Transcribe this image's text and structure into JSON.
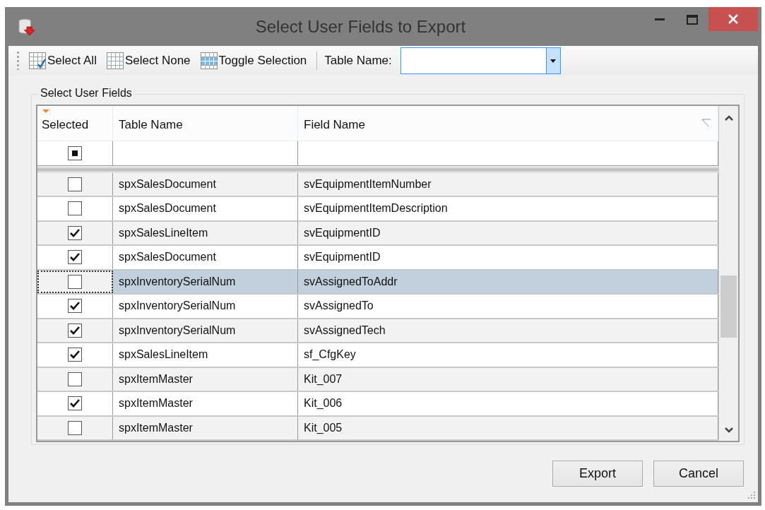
{
  "window": {
    "title": "Select User Fields to Export"
  },
  "toolbar": {
    "buttons": [
      {
        "label": "Select All",
        "kind": "all"
      },
      {
        "label": "Select None",
        "kind": "none"
      },
      {
        "label": "Toggle Selection",
        "kind": "toggle"
      }
    ],
    "table_name_label": "Table Name:"
  },
  "group": {
    "title": "Select User Fields"
  },
  "table": {
    "columns": [
      "Selected",
      "Table Name",
      "Field Name"
    ],
    "filter_checkbox": {
      "indeterminate": true
    },
    "rows": [
      {
        "table": "spxSalesDocument",
        "field": "svEquipmentItemNumber",
        "checked": false,
        "selected": false,
        "focused": false
      },
      {
        "table": "spxSalesDocument",
        "field": "svEquipmentItemDescription",
        "checked": false,
        "selected": false,
        "focused": false
      },
      {
        "table": "spxSalesLineItem",
        "field": "svEquipmentID",
        "checked": true,
        "selected": false,
        "focused": false
      },
      {
        "table": "spxSalesDocument",
        "field": "svEquipmentID",
        "checked": true,
        "selected": false,
        "focused": false
      },
      {
        "table": "spxInventorySerialNum",
        "field": "svAssignedToAddr",
        "checked": false,
        "selected": true,
        "focused": true
      },
      {
        "table": "spxInventorySerialNum",
        "field": "svAssignedTo",
        "checked": true,
        "selected": false,
        "focused": false
      },
      {
        "table": "spxInventorySerialNum",
        "field": "svAssignedTech",
        "checked": true,
        "selected": false,
        "focused": false
      },
      {
        "table": "spxSalesLineItem",
        "field": "sf_CfgKey",
        "checked": true,
        "selected": false,
        "focused": false
      },
      {
        "table": "spxItemMaster",
        "field": "Kit_007",
        "checked": false,
        "selected": false,
        "focused": false
      },
      {
        "table": "spxItemMaster",
        "field": "Kit_006",
        "checked": true,
        "selected": false,
        "focused": false
      },
      {
        "table": "spxItemMaster",
        "field": "Kit_005",
        "checked": false,
        "selected": false,
        "focused": false
      }
    ]
  },
  "buttons": [
    "Export",
    "Cancel"
  ]
}
